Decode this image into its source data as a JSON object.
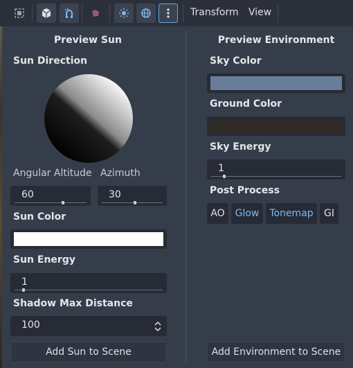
{
  "toolbar": {
    "menus": [
      "Transform",
      "View"
    ]
  },
  "sun_panel": {
    "title": "Preview Sun",
    "direction_label": "Sun Direction",
    "altitude_label": "Angular Altitude",
    "azimuth_label": "Azimuth",
    "altitude_value": "60",
    "altitude_level": 0.67,
    "azimuth_value": "30",
    "azimuth_level": 0.55,
    "color_label": "Sun Color",
    "color_value": "#ffffff",
    "energy_label": "Sun Energy",
    "energy_value": "1",
    "energy_level": 0.0625,
    "shadow_label": "Shadow Max Distance",
    "shadow_value": "100",
    "add_button": "Add Sun to Scene"
  },
  "env_panel": {
    "title": "Preview Environment",
    "sky_color_label": "Sky Color",
    "sky_color_value": "#697d9a",
    "ground_color_label": "Ground Color",
    "ground_color_value": "#302a24",
    "sky_energy_label": "Sky Energy",
    "sky_energy_value": "1",
    "sky_energy_level": 0.1,
    "post_process_label": "Post Process",
    "post_process": [
      {
        "label": "AO",
        "on": false
      },
      {
        "label": "Glow",
        "on": true
      },
      {
        "label": "Tonemap",
        "on": true
      },
      {
        "label": "GI",
        "on": false
      }
    ],
    "add_button": "Add Environment to Scene"
  },
  "colors": {
    "accent": "#5fa8e8",
    "background": "#363d4a",
    "toolbar": "#2b303b"
  }
}
